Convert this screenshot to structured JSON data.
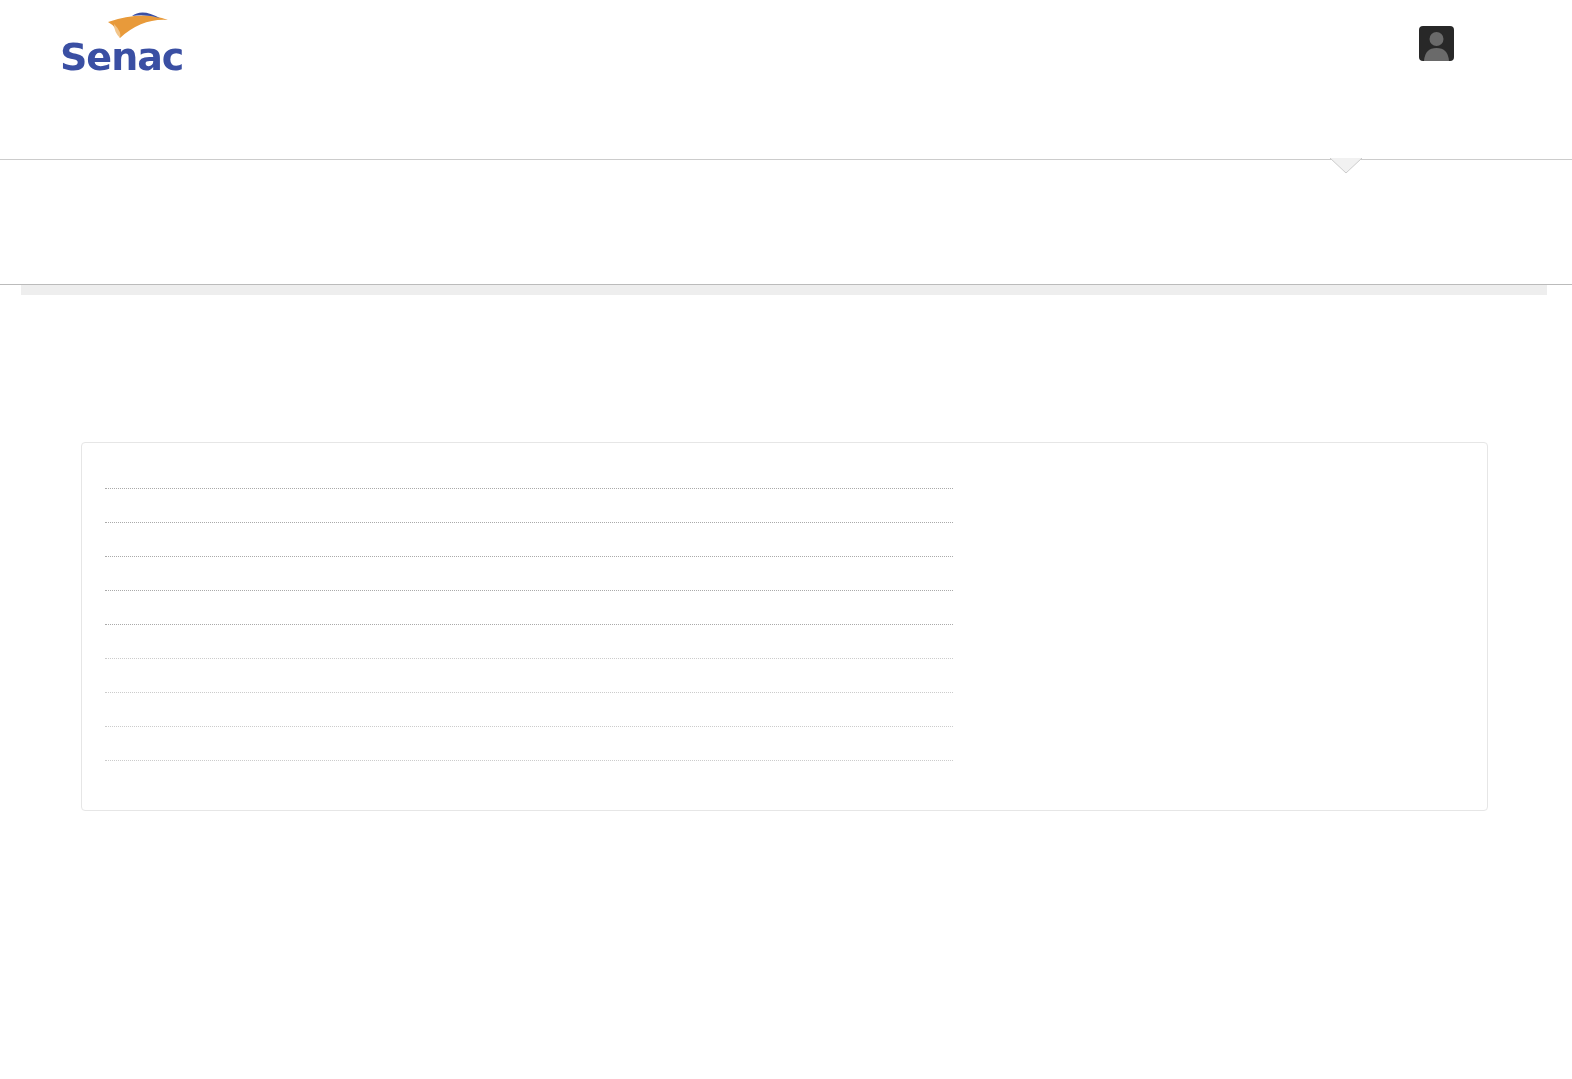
{
  "header": {
    "logo": {
      "text": "Senac"
    },
    "user_menu": {
      "kind": "avatar"
    }
  },
  "table": {
    "rows": [
      {
        "kind": "empty"
      },
      {
        "kind": "empty"
      },
      {
        "kind": "empty"
      },
      {
        "kind": "empty"
      },
      {
        "kind": "empty"
      },
      {
        "kind": "empty"
      },
      {
        "kind": "empty"
      },
      {
        "kind": "empty"
      },
      {
        "kind": "empty"
      }
    ]
  }
}
